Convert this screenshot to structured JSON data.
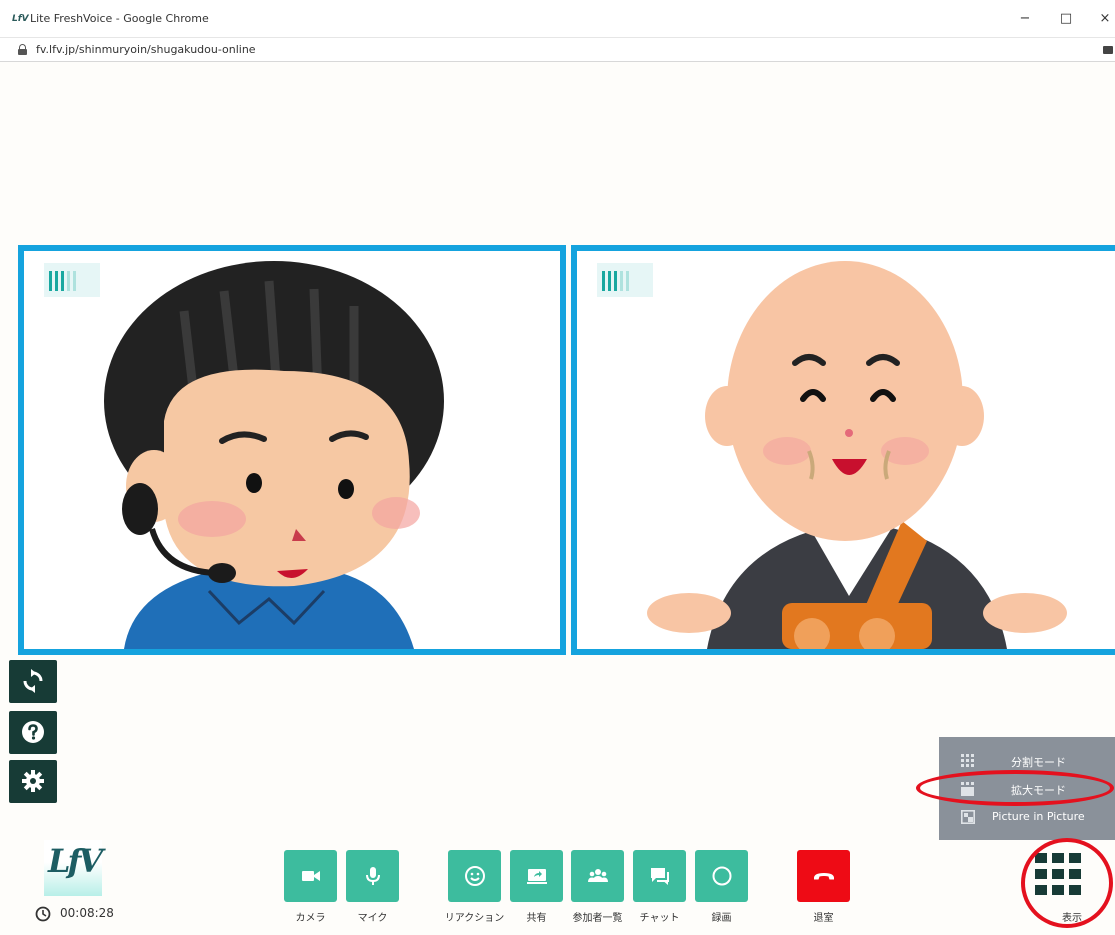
{
  "window": {
    "app_icon": "LfV",
    "title": "Lite FreshVoice - Google Chrome",
    "minimize": "−",
    "maximize": "□",
    "close": "×",
    "url": "fv.lfv.jp/shinmuryoin/shugakudou-online"
  },
  "tiles": [
    {
      "name": "participant-tile-left",
      "level_bars_active": 3
    },
    {
      "name": "participant-tile-right",
      "level_bars_active": 3
    }
  ],
  "sidebar": {
    "items": [
      {
        "id": "refresh",
        "icon": "refresh-icon"
      },
      {
        "id": "help",
        "icon": "help-icon"
      },
      {
        "id": "settings",
        "icon": "gear-icon"
      }
    ]
  },
  "view_menu": {
    "items": [
      {
        "label": "分割モード",
        "icon": "grid-icon"
      },
      {
        "label": "拡大モード",
        "icon": "enlarge-icon",
        "highlighted": true
      },
      {
        "label": "Picture in Picture",
        "icon": "pip-icon"
      }
    ]
  },
  "logo_text": "LfV",
  "timer": "00:08:28",
  "toolbar": {
    "camera_label": "カメラ",
    "mic_label": "マイク",
    "reaction_label": "リアクション",
    "share_label": "共有",
    "participants_label": "参加者一覧",
    "chat_label": "チャット",
    "record_label": "録画",
    "leave_label": "退室",
    "display_label": "表示"
  },
  "colors": {
    "accent": "#3dbc9e",
    "leave": "#ee0b15",
    "tile_border": "#15a3de",
    "sidebar": "#173b36",
    "menu_bg": "#8a919a",
    "highlight": "#e4111e"
  }
}
